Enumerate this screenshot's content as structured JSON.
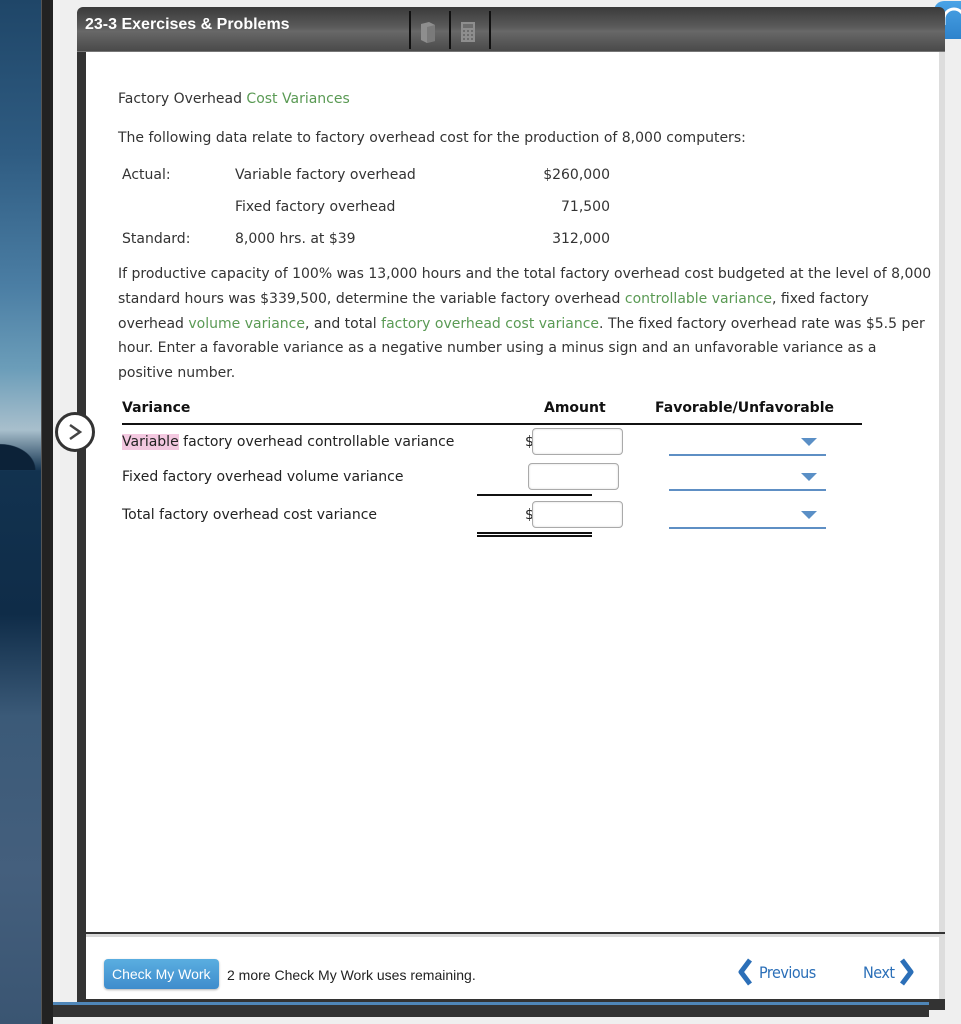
{
  "window": {
    "title": "23-3 Exercises & Problems",
    "toolbar_icons": [
      "book-icon",
      "calculator-icon"
    ]
  },
  "problem": {
    "heading_prefix": "Factory Overhead ",
    "heading_link": "Cost Variances",
    "intro": "The following data relate to factory overhead cost for the production of 8,000 computers:",
    "data_rows": [
      {
        "label": "Actual:",
        "description": "Variable factory overhead",
        "value": "$260,000"
      },
      {
        "label": "",
        "description": "Fixed factory overhead",
        "value": "71,500"
      },
      {
        "label": "Standard:",
        "description": "8,000 hrs. at $39",
        "value": "312,000"
      }
    ],
    "paragraph": {
      "p1": "If productive capacity of 100% was 13,000 hours and the total factory overhead cost budgeted at the level of 8,000 standard hours was $339,500, determine the variable factory overhead ",
      "link1": "controllable variance",
      "p2": ", fixed factory overhead ",
      "link2": "volume variance",
      "p3": ", and total ",
      "link3": "factory overhead cost variance",
      "p4": ". The fixed factory overhead rate was $5.5 per hour. Enter a favorable variance as a negative number using a minus sign and an unfavorable variance as a positive number."
    }
  },
  "variance_table": {
    "headers": {
      "variance": "Variance",
      "amount": "Amount",
      "fav_unfav": "Favorable/Unfavorable"
    },
    "rows": [
      {
        "label_highlight": "Variable",
        "label_rest": " factory overhead controllable variance",
        "currency": "$",
        "amount": "",
        "selection": ""
      },
      {
        "label_highlight": "",
        "label_rest": "Fixed factory overhead volume variance",
        "currency": "",
        "amount": "",
        "selection": ""
      },
      {
        "label_highlight": "",
        "label_rest": "Total factory overhead cost variance",
        "currency": "$",
        "amount": "",
        "selection": ""
      }
    ]
  },
  "footer": {
    "check_button": "Check My Work",
    "remaining_text": "2 more Check My Work uses remaining.",
    "previous": "Previous",
    "next": "Next"
  },
  "colors": {
    "link_green": "#5a9a54",
    "accent_blue": "#2b6fb8",
    "highlight_pink": "#f3c8e0"
  }
}
